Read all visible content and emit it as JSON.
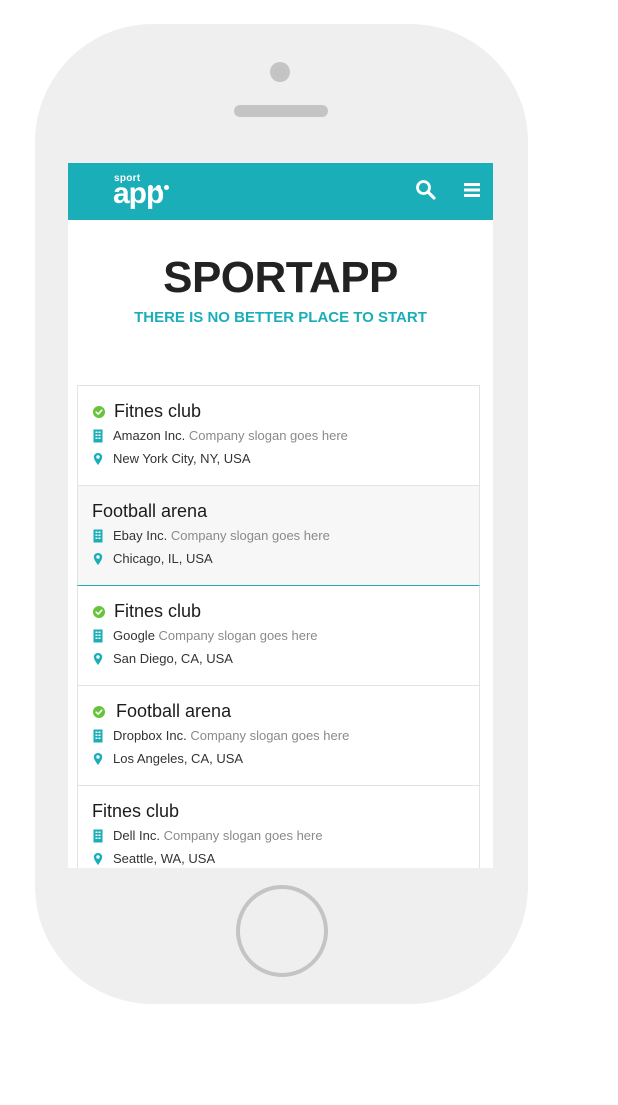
{
  "app": {
    "logo_small": "sport",
    "logo_big": "app",
    "accent_color": "#1aaeb8",
    "check_color": "#66c43a"
  },
  "hero": {
    "title": "SPORTAPP",
    "subtitle": "THERE IS NO BETTER PLACE TO START"
  },
  "icons": {
    "search": "search-icon",
    "menu": "menu-icon",
    "verified": "check-circle-icon",
    "company": "building-icon",
    "location": "map-pin-icon"
  },
  "listings": [
    {
      "title": "Fitnes club",
      "verified": true,
      "company": "Amazon Inc.",
      "slogan": "Company slogan goes here",
      "location": "New York City, NY, USA"
    },
    {
      "title": "Football arena",
      "verified": false,
      "company": "Ebay Inc.",
      "slogan": "Company slogan goes here",
      "location": "Chicago, IL, USA"
    },
    {
      "title": "Fitnes club",
      "verified": true,
      "company": "Google",
      "slogan": "Company slogan goes here",
      "location": "San Diego, CA, USA"
    },
    {
      "title": "Football arena",
      "verified": true,
      "company": "Dropbox Inc.",
      "slogan": "Company slogan goes here",
      "location": "Los Angeles, CA, USA"
    },
    {
      "title": "Fitnes club",
      "verified": false,
      "company": "Dell Inc.",
      "slogan": "Company slogan goes here",
      "location": "Seattle, WA, USA"
    }
  ]
}
